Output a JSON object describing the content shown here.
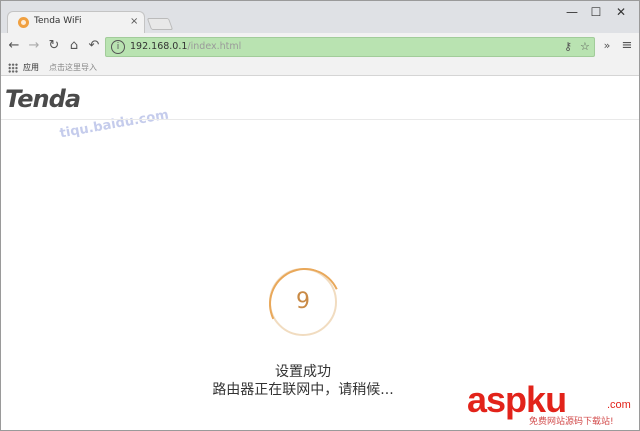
{
  "browser": {
    "tab": {
      "title": "Tenda WiFi",
      "close_glyph": "×"
    },
    "window_controls": {
      "minimize": "—",
      "maximize": "☐",
      "close": "✕"
    },
    "nav_icons": [
      "back-icon",
      "forward-icon",
      "reload-icon",
      "home-icon",
      "undo-icon"
    ],
    "address": {
      "host": "192.168.0.1",
      "path": "/index.html"
    },
    "bookmarks": {
      "apps_label": "应用",
      "hint": "点击这里导入"
    }
  },
  "page": {
    "logo": "Tenda",
    "countdown": "9",
    "success_message": "设置成功",
    "wait_message": "路由器正在联网中，请稍候..."
  },
  "watermarks": {
    "diagonal": "tiqu.baidu.com",
    "brand": "asp",
    "brand_ku": "ku",
    "brand_com": ".com",
    "caption": "免费网站源码下载站!"
  },
  "colors": {
    "omnibox_bg": "#b9e3b1",
    "ring_accent": "#e9a85a",
    "watermark_red": "#e2231a"
  }
}
